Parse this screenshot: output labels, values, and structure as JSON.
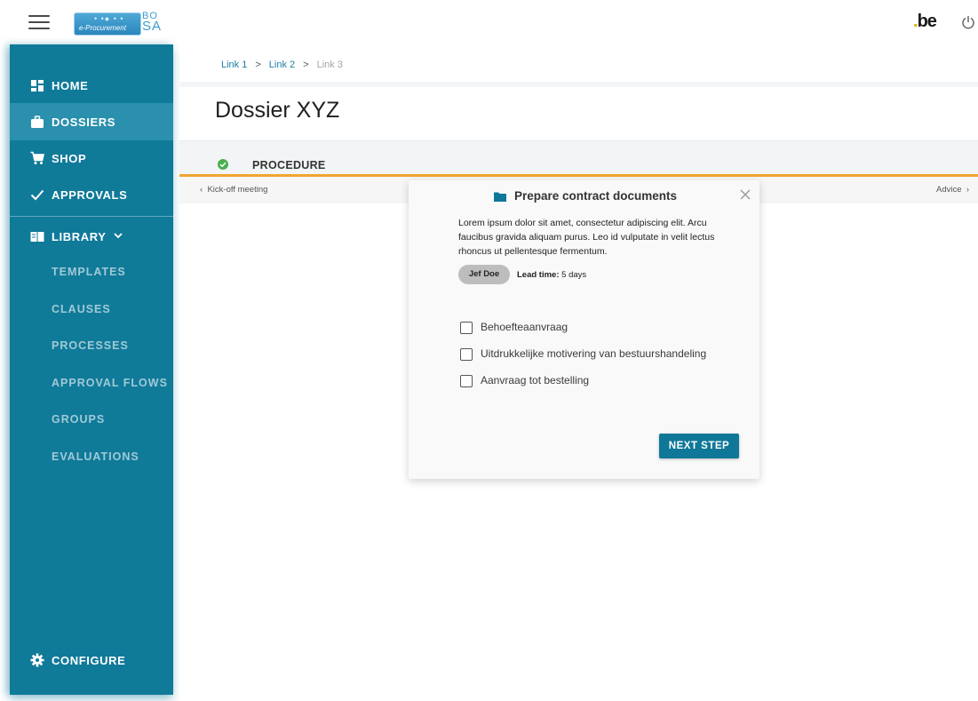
{
  "header": {
    "logo_text": "e-Procurement",
    "logo_dots": "• •● • •",
    "bosa_line1": "BO",
    "bosa_line2": "SA",
    "be_logo": "be",
    "be_dot": "."
  },
  "sidebar": {
    "items": [
      {
        "label": "HOME",
        "icon": "dashboard-icon"
      },
      {
        "label": "DOSSIERS",
        "icon": "briefcase-icon",
        "active": true
      },
      {
        "label": "SHOP",
        "icon": "cart-icon"
      },
      {
        "label": "APPROVALS",
        "icon": "check-icon"
      }
    ],
    "library": {
      "label": "LIBRARY",
      "icon": "book-icon"
    },
    "library_items": [
      "TEMPLATES",
      "CLAUSES",
      "PROCESSES",
      "APPROVAL FLOWS",
      "GROUPS",
      "EVALUATIONS"
    ],
    "configure": {
      "label": "CONFIGURE",
      "icon": "gear-icon"
    }
  },
  "breadcrumb": {
    "link1": "Link 1",
    "link2": "Link 2",
    "link3": "Link 3",
    "sep": ">"
  },
  "page": {
    "title": "Dossier XYZ"
  },
  "procedure": {
    "label": "PROCEDURE",
    "prev_step": "Kick-off meeting",
    "next_step": "Advice"
  },
  "card": {
    "title": "Prepare contract documents",
    "body": "Lorem ipsum dolor sit amet, consectetur adipiscing elit. Arcu faucibus gravida aliquam purus. Leo id vulputate in velit lectus rhoncus ut pellentesque fermentum.",
    "chip": "Jef Doe",
    "lead_label": "Lead time:",
    "lead_value": "5 days",
    "checks": [
      "Behoefteaanvraag",
      "Uitdrukkelijke motivering van bestuurshandeling",
      "Aanvraag tot bestelling"
    ],
    "button": "NEXT STEP"
  },
  "colors": {
    "sidebar": "#107a99",
    "sidebar_active": "#2a90ad",
    "accent_orange": "#f0a531",
    "primary_button": "#0f7898",
    "success_green": "#4caf50"
  }
}
